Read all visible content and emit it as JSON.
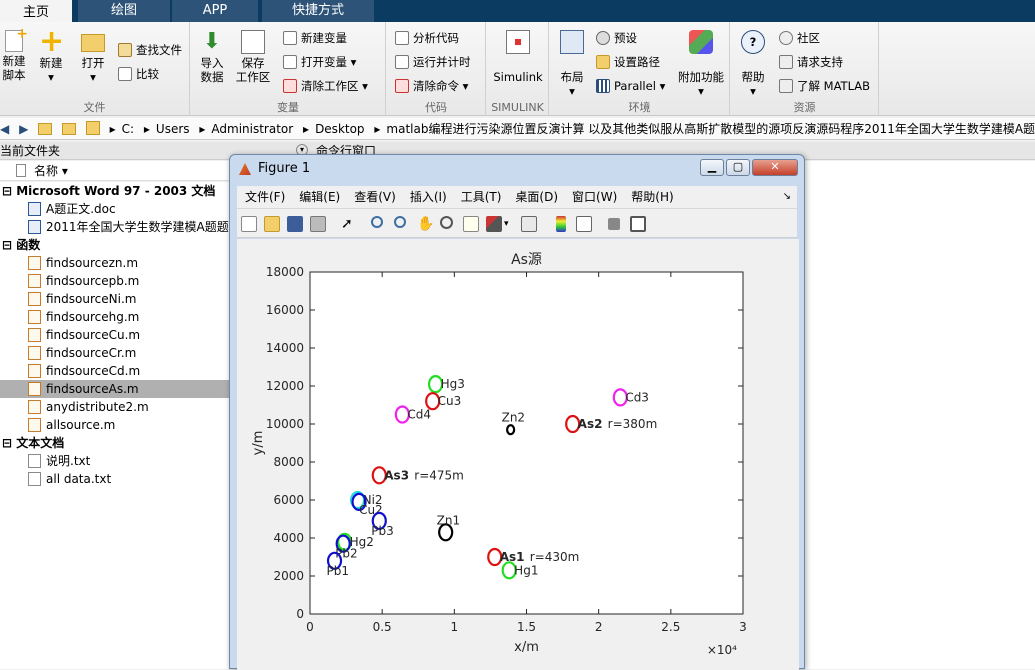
{
  "tabs": [
    "主页",
    "绘图",
    "APP",
    "快捷方式"
  ],
  "ribbon": {
    "file": {
      "label": "文件",
      "new_script": "新建\n脚本",
      "new": "新建",
      "open": "打开",
      "find_files": "查找文件",
      "compare": "比较"
    },
    "variable": {
      "label": "变量",
      "import": "导入\n数据",
      "save_ws": "保存\n工作区",
      "new_var": "新建变量",
      "open_var": "打开变量",
      "clear_ws": "清除工作区"
    },
    "code": {
      "label": "代码",
      "analyze": "分析代码",
      "run_time": "运行并计时",
      "clear_cmd": "清除命令"
    },
    "simulink": {
      "label": "SIMULINK",
      "btn": "Simulink"
    },
    "env": {
      "label": "环境",
      "layout": "布局",
      "prefs": "预设",
      "set_path": "设置路径",
      "parallel": "Parallel",
      "addons": "附加功能"
    },
    "res": {
      "label": "资源",
      "help": "帮助",
      "community": "社区",
      "support": "请求支持",
      "learn": "了解 MATLAB"
    }
  },
  "address": [
    "C:",
    "Users",
    "Administrator",
    "Desktop",
    "matlab编程进行污染源位置反演计算 以及其他类似服从高斯扩散模型的源项反演源码程序2011年全国大学生数学建模A题"
  ],
  "panels": {
    "current_folder": "当前文件夹",
    "command_window": "命令行窗口",
    "name_col": "名称 ▾"
  },
  "files": [
    {
      "text": "Microsoft Word 97 - 2003 文档",
      "kind": "group"
    },
    {
      "text": "A题正文.doc",
      "kind": "w"
    },
    {
      "text": "2011年全国大学生数学建模A题题",
      "kind": "w"
    },
    {
      "text": "函数",
      "kind": "group"
    },
    {
      "text": "findsourcezn.m",
      "kind": "m"
    },
    {
      "text": "findsourcepb.m",
      "kind": "m"
    },
    {
      "text": "findsourceNi.m",
      "kind": "m"
    },
    {
      "text": "findsourcehg.m",
      "kind": "m"
    },
    {
      "text": "findsourceCu.m",
      "kind": "m"
    },
    {
      "text": "findsourceCr.m",
      "kind": "m"
    },
    {
      "text": "findsourceCd.m",
      "kind": "m"
    },
    {
      "text": "findsourceAs.m",
      "kind": "m",
      "selected": true
    },
    {
      "text": "anydistribute2.m",
      "kind": "m"
    },
    {
      "text": "allsource.m",
      "kind": "m"
    },
    {
      "text": "文本文档",
      "kind": "group"
    },
    {
      "text": "说明.txt",
      "kind": "t"
    },
    {
      "text": "all data.txt",
      "kind": "t"
    }
  ],
  "figure": {
    "title": "Figure 1",
    "menu": [
      "文件(F)",
      "编辑(E)",
      "查看(V)",
      "插入(I)",
      "工具(T)",
      "桌面(D)",
      "窗口(W)",
      "帮助(H)"
    ]
  },
  "chart_data": {
    "type": "scatter",
    "title": "As源",
    "xlabel": "x/m",
    "ylabel": "y/m",
    "xlim": [
      0,
      30000
    ],
    "ylim": [
      0,
      18000
    ],
    "xticks": [
      "0",
      "0.5",
      "1",
      "1.5",
      "2",
      "2.5",
      "3"
    ],
    "xtick_values": [
      0,
      5000,
      10000,
      15000,
      20000,
      25000,
      30000
    ],
    "x_exponent": "×10⁴",
    "yticks": [
      "0",
      "2000",
      "4000",
      "6000",
      "8000",
      "10000",
      "12000",
      "14000",
      "16000",
      "18000"
    ],
    "ytick_values": [
      0,
      2000,
      4000,
      6000,
      8000,
      10000,
      12000,
      14000,
      16000,
      18000
    ],
    "grid": false,
    "points": [
      {
        "label": "Hg3",
        "x": 8700,
        "y": 12100,
        "color": "#22dd22"
      },
      {
        "label": "Cu3",
        "x": 8500,
        "y": 11200,
        "color": "#dd1111"
      },
      {
        "label": "Cd4",
        "x": 6400,
        "y": 10500,
        "color": "#ee22ee"
      },
      {
        "label": "Cd3",
        "x": 21500,
        "y": 11400,
        "color": "#ee22ee"
      },
      {
        "label": "Zn2",
        "x": 13900,
        "y": 9700,
        "color": "#000000"
      },
      {
        "label": "As2",
        "x": 18200,
        "y": 10000,
        "color": "#dd1111",
        "note": "r=380m",
        "bold": true
      },
      {
        "label": "As3",
        "x": 4800,
        "y": 7300,
        "color": "#dd1111",
        "note": "r=475m",
        "bold": true
      },
      {
        "label": "Ni2",
        "x": 3300,
        "y": 6000,
        "color": "#22dddd"
      },
      {
        "label": "Cu2",
        "x": 3400,
        "y": 5900,
        "color": "#1111cc"
      },
      {
        "label": "Pb3",
        "x": 4800,
        "y": 4900,
        "color": "#1111cc"
      },
      {
        "label": "Zn1",
        "x": 9400,
        "y": 4300,
        "color": "#000000"
      },
      {
        "label": "Hg2",
        "x": 2400,
        "y": 3800,
        "color": "#22dd22"
      },
      {
        "label": "Pb2",
        "x": 2300,
        "y": 3700,
        "color": "#1111cc"
      },
      {
        "label": "Pb1",
        "x": 1700,
        "y": 2800,
        "color": "#1111cc"
      },
      {
        "label": "As1",
        "x": 12800,
        "y": 3000,
        "color": "#dd1111",
        "note": "r=430m",
        "bold": true
      },
      {
        "label": "Hg1",
        "x": 13800,
        "y": 2300,
        "color": "#22dd22"
      }
    ]
  }
}
